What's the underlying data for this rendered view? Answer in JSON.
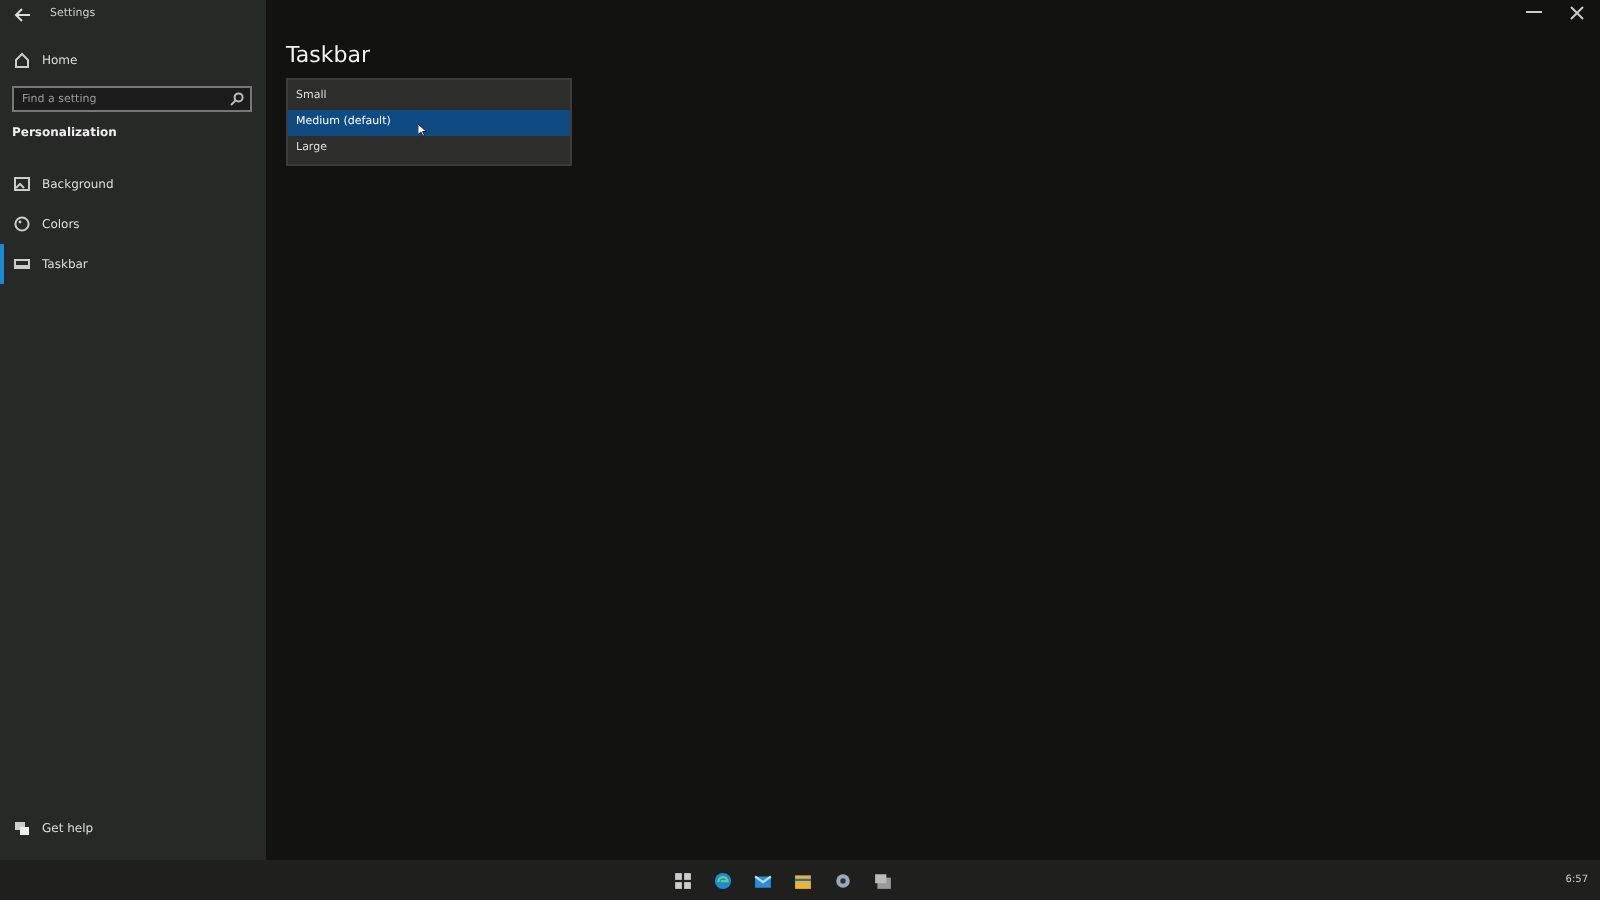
{
  "window": {
    "title": "Settings"
  },
  "sidebar": {
    "home": "Home",
    "search": {
      "placeholder": "Find a setting"
    },
    "section": "Personalization",
    "items": [
      {
        "label": "Background",
        "kind": "picture",
        "selected": false
      },
      {
        "label": "Colors",
        "kind": "palette",
        "selected": false
      },
      {
        "label": "Taskbar",
        "kind": "taskbar",
        "selected": true
      }
    ],
    "help": "Get help"
  },
  "page": {
    "title": "Taskbar",
    "dropdown": [
      {
        "label": "Small",
        "selected": false
      },
      {
        "label": "Medium (default)",
        "selected": true
      },
      {
        "label": "Large",
        "selected": false
      }
    ]
  },
  "taskbar": {
    "clock": "6:57"
  }
}
